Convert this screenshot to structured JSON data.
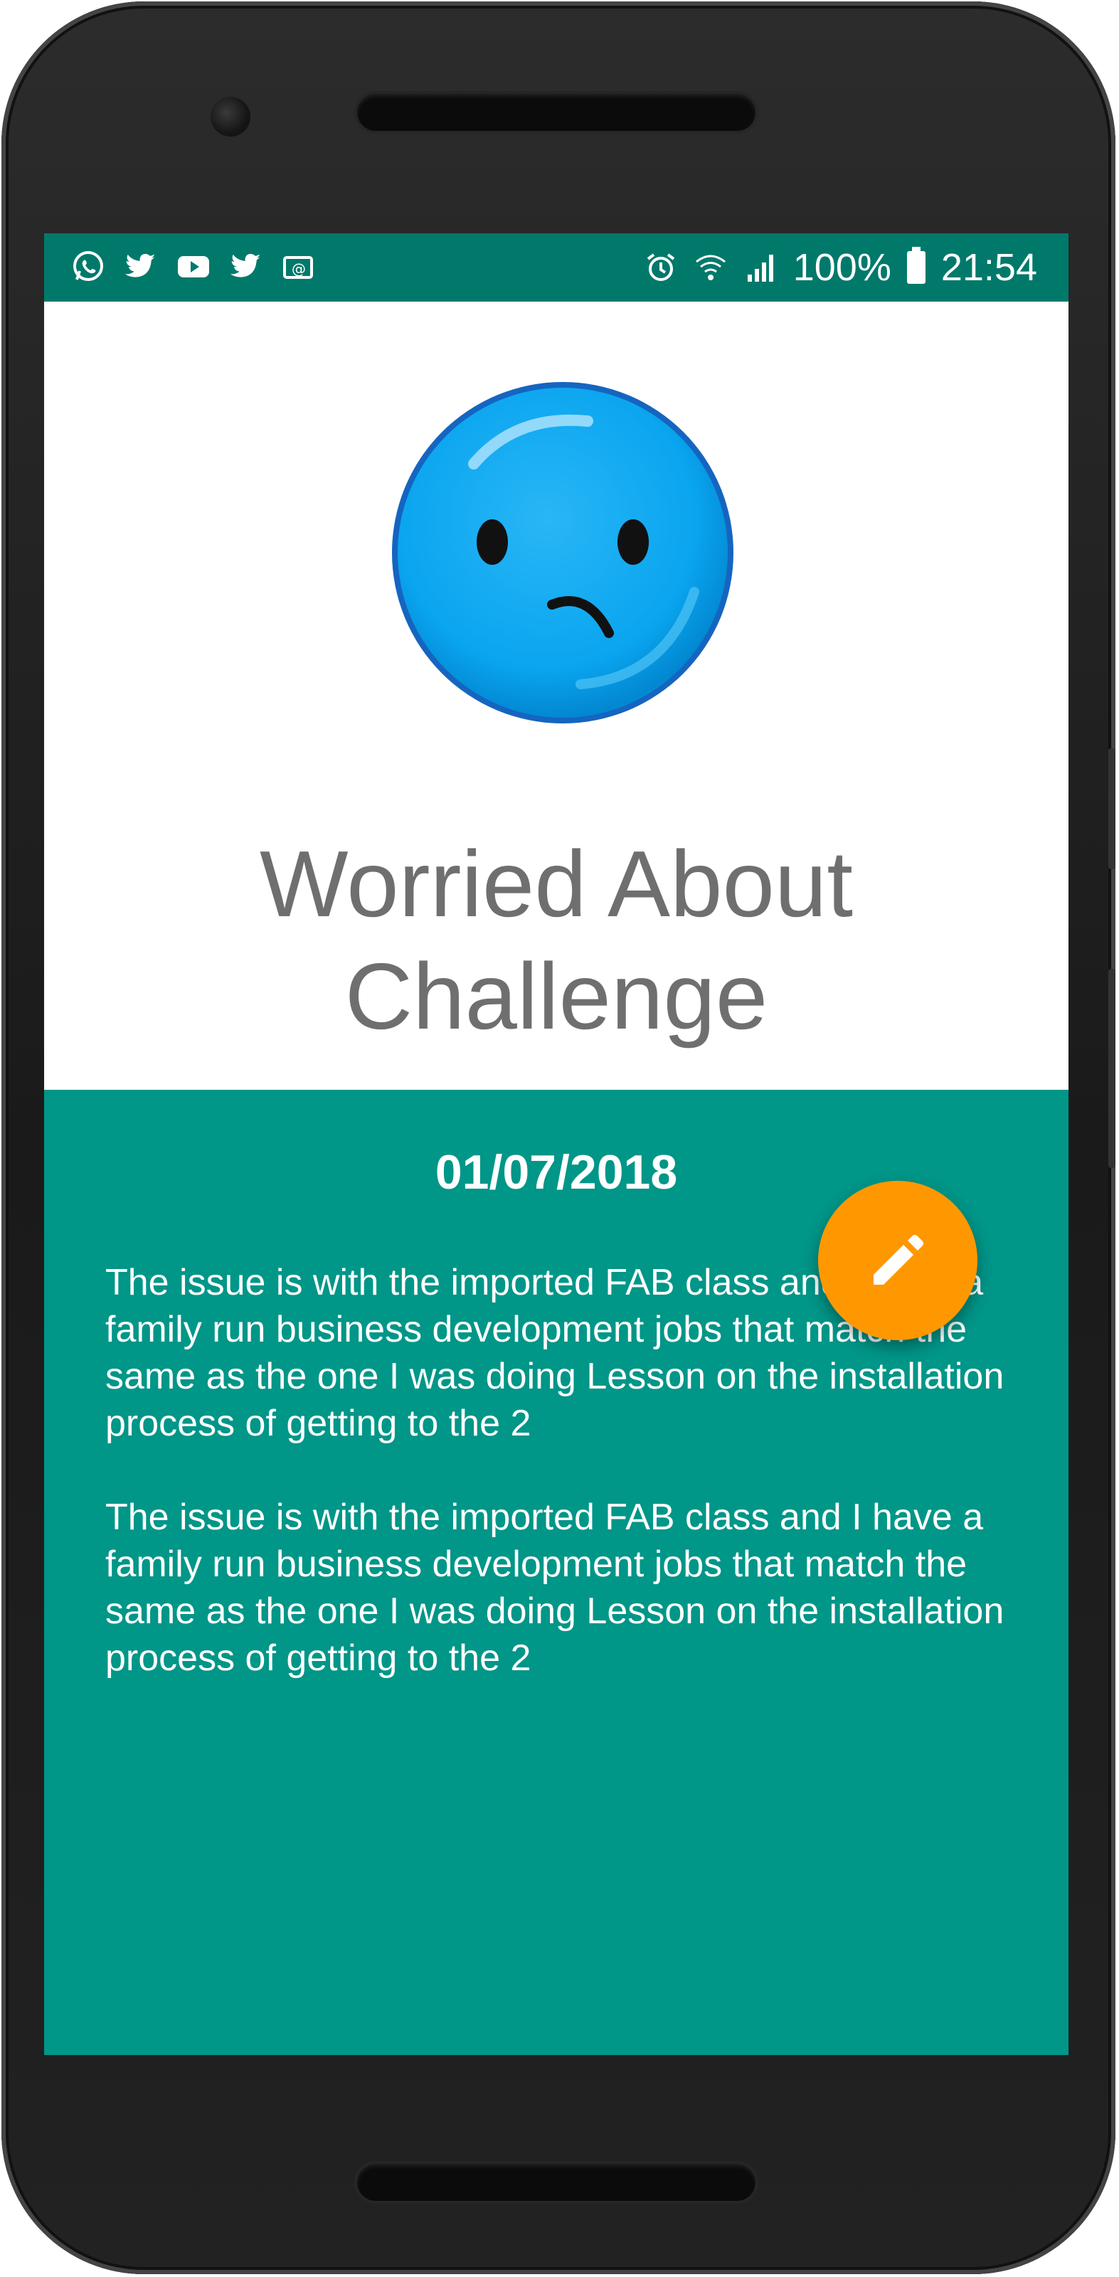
{
  "status_bar": {
    "notification_icons": [
      "whatsapp-icon",
      "twitter-icon",
      "youtube-icon",
      "twitter-icon",
      "email-icon"
    ],
    "system_icons": [
      "alarm-icon",
      "wifi-icon",
      "signal-icon"
    ],
    "battery_percent": "100%",
    "time": "21:54",
    "color": "#00796b"
  },
  "mood": {
    "icon": "worried-face-icon",
    "title": "Worried About Challenge"
  },
  "entry": {
    "date": "01/07/2018",
    "paragraphs": [
      "The issue is with the imported FAB class and I have a family run business development jobs that match the same as the one I was doing Lesson on the installation process of getting to the 2",
      "The issue is with the imported FAB class and I have a family run business development jobs that match the same as the one I was doing Lesson on the installation process of getting to the 2"
    ],
    "background_color": "#009688"
  },
  "fab": {
    "icon": "edit-pencil-icon",
    "color": "#ff9800"
  }
}
